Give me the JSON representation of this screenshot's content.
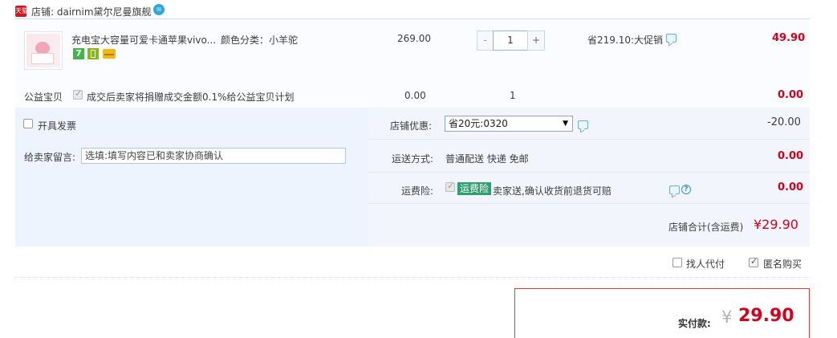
{
  "shop": {
    "badge": "天猫",
    "label": "店铺: dairnim黛尔尼曼旗舰",
    "wangwang_icon": "wangwang-chat-icon"
  },
  "item": {
    "title": "充电宝大容量可爱卡通苹果vivo...",
    "sku": "颜色分类：小羊驼",
    "price": "269.00",
    "qty": "1",
    "qty_minus": "-",
    "qty_plus": "+",
    "promo": "省219.10:大促销",
    "subtotal": "49.90",
    "badges": [
      "7",
      "charge",
      "card"
    ],
    "badge_7": "7"
  },
  "charity": {
    "label": "公益宝贝",
    "desc": "成交后卖家将捐赠成交金额0.1%给公益宝贝计划",
    "price": "0.00",
    "qty": "1",
    "subtotal": "0.00"
  },
  "invoice": {
    "label": "开具发票"
  },
  "discount": {
    "label": "店铺优惠:",
    "selected": "省20元:0320",
    "arrow": "▼",
    "amount": "-20.00"
  },
  "message": {
    "label": "给卖家留言:",
    "value": "选填:填写内容已和卖家协商确认"
  },
  "shipping": {
    "label": "运送方式:",
    "value": "普通配送 快递 免邮",
    "amount": "0.00"
  },
  "insurance": {
    "label": "运费险:",
    "badge": "运费险",
    "desc": "卖家送,确认收货前退货可赔",
    "amount": "0.00",
    "help": "?"
  },
  "shop_total": {
    "label": "店铺合计(含运费)",
    "amount": "¥29.90"
  },
  "options": {
    "proxy": "找人代付",
    "anonymous": "匿名购买"
  },
  "payment": {
    "label": "实付款:",
    "yen": "¥",
    "amount": "29.90"
  },
  "colors": {
    "accent_red": "#d6001c",
    "panel_blue": "#eef4fd",
    "border_blue": "#cfdef0",
    "insurance_green": "#2c9f6d"
  }
}
